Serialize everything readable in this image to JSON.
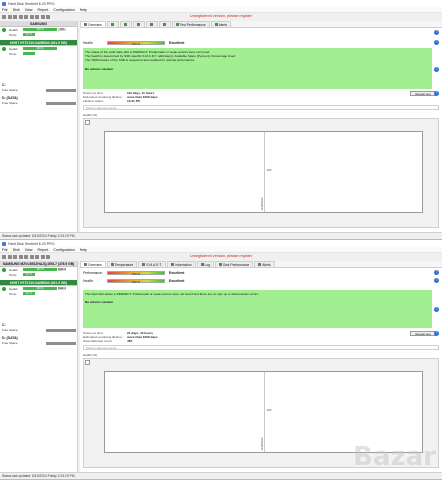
{
  "colors": {
    "register_red": "#d21e1e",
    "health_green": "#a2ef92",
    "selected_disk_green": "#2e8b3a",
    "help_blue": "#2a6fd1"
  },
  "icons": [
    "app-icon",
    "toolbar-icons",
    "disk-ok-dot-icon",
    "tab-icon",
    "help-icon",
    "chart-button-icon"
  ],
  "windows": [
    {
      "title": "Hard Disk Sentinel 6.20 PRO",
      "menu": [
        "File",
        "Disk",
        "View",
        "Report",
        "Configuration",
        "Help"
      ],
      "register": "Unregistered version, please register",
      "disks": [
        {
          "name": "SAMSUNG",
          "selected": false,
          "health_label": "Health",
          "health_value": "100 %",
          "health_box": "OK",
          "temp_label": "Temp.",
          "temp_value": "34 °C",
          "temp_box": ""
        },
        {
          "name": "HGST HTS721010A9E630 (931.5 GB)",
          "selected": true,
          "health_label": "Health",
          "health_value": "100 %",
          "health_box": "",
          "temp_label": "Temp.",
          "temp_value": "",
          "temp_box": ""
        }
      ],
      "volumes": [
        {
          "name": "C:",
          "size": "",
          "free_label": "Free Space",
          "free_value": ""
        },
        {
          "name": "D: (DATA)",
          "size": "",
          "free_label": "Free Space",
          "free_value": ""
        }
      ],
      "tabs": [
        "Overview",
        "",
        "",
        "",
        "",
        "",
        "Test Performance",
        "Alerts"
      ],
      "active_tab": 0,
      "performance": {
        "label": "",
        "bar": "",
        "value": ""
      },
      "health": {
        "label": "Health",
        "bar": "100 %",
        "value": "Excellent"
      },
      "health_text": [
        "The status of the solid state disk is PERFECT. Problematic or weak sectors were not found.",
        "The health is determined by SSD specific S.M.A.R.T. attribute(s): Available Spare (Percent), Percentage Used",
        "The TRIM feature of the SSD is supported and enabled for optimal performance."
      ],
      "health_action": "No actions needed.",
      "info": [
        {
          "k": "Power on time:",
          "v": "112 days, 11 hours"
        },
        {
          "k": "Estimated remaining lifetime:",
          "v": "more than 1000 days"
        },
        {
          "k": "Lifetime writes:",
          "v": "10.41 TB"
        }
      ],
      "report_button": "Repeat test",
      "comment_placeholder": "Click to add comments...",
      "chart_title": "Health (%)",
      "chart_y_tick": "100",
      "chart_x_tick": "6/19/2024",
      "statusbar": "Status last updated: 6/19/2024 Friday 2:24:19 PM"
    },
    {
      "title": "Hard Disk Sentinel 6.20 PRO",
      "menu": [
        "File",
        "Disk",
        "View",
        "Report",
        "Configuration",
        "Help"
      ],
      "register": "Unregistered version, please register",
      "disks": [
        {
          "name": "SAMSUNG MZVLB512HAJQ-000L7 (476.9 GB)",
          "selected": false,
          "health_label": "Health",
          "health_value": "100 %",
          "health_box": "Disk: 0",
          "temp_label": "Temp.",
          "temp_value": "34 °C",
          "temp_box": ""
        },
        {
          "name": "HGST HTS721010A9E630 (931.5 GB)",
          "selected": true,
          "health_label": "Health",
          "health_value": "100 %",
          "health_box": "Disk: 1",
          "temp_label": "Temp.",
          "temp_value": "34 °C",
          "temp_box": ""
        }
      ],
      "volumes": [
        {
          "name": "C:",
          "size": "",
          "free_label": "Free Space",
          "free_value": ""
        },
        {
          "name": "D: (DATA)",
          "size": "",
          "free_label": "Free Space",
          "free_value": ""
        }
      ],
      "tabs": [
        "Overview",
        "Temperature",
        "S.M.A.R.T.",
        "Information",
        "Log",
        "Disk Performance",
        "Alerts"
      ],
      "active_tab": 0,
      "performance": {
        "label": "Performance:",
        "bar": "100 %",
        "value": "Excellent"
      },
      "health": {
        "label": "Health:",
        "bar": "100 %",
        "value": "Excellent"
      },
      "health_text": [
        "The hard disk status is PERFECT. Problematic or weak sectors were not found and there are no spin up or data transfer errors."
      ],
      "health_action": "No actions needed.",
      "info": [
        {
          "k": "Power on time:",
          "v": "21 days, 10 hours"
        },
        {
          "k": "Estimated remaining lifetime:",
          "v": "more than 1000 days"
        },
        {
          "k": "Total start/stop count:",
          "v": "455"
        }
      ],
      "report_button": "Repeat test",
      "comment_placeholder": "Click to add comments...",
      "chart_title": "Health (%)",
      "chart_y_tick": "100",
      "chart_x_tick": "6/19/2024",
      "statusbar": "Status last updated: 6/19/2024 Friday 2:24:19 PM"
    }
  ],
  "watermark": "Bazar"
}
